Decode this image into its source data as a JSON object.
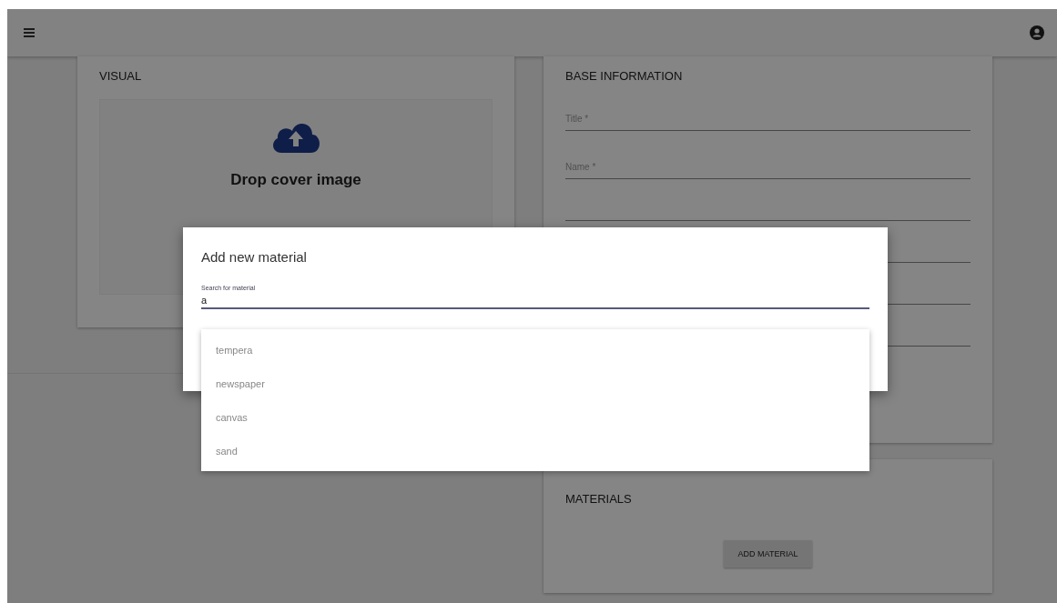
{
  "visual": {
    "title": "VISUAL",
    "drop_text": "Drop cover image"
  },
  "base_information": {
    "title": "BASE INFORMATION",
    "fields": [
      {
        "label": "Title *"
      },
      {
        "label": "Name *"
      }
    ]
  },
  "materials": {
    "title": "MATERIALS",
    "button": "ADD MATERIAL"
  },
  "dialog": {
    "title": "Add new material",
    "search": {
      "label": "Search for material",
      "value": "a"
    },
    "options": [
      "tempera",
      "newspaper",
      "canvas",
      "sand"
    ]
  }
}
